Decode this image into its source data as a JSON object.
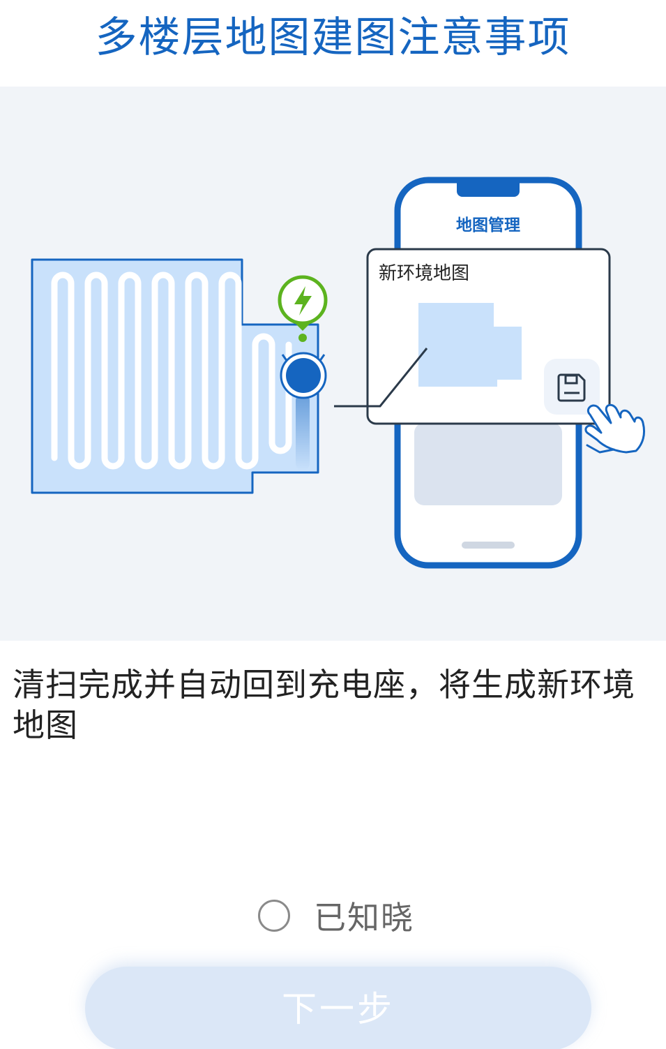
{
  "page": {
    "title": "多楼层地图建图注意事项",
    "description": "清扫完成并自动回到充电座，将生成新环境地图"
  },
  "illustration": {
    "phone_header": "地图管理",
    "popup_title": "新环境地图",
    "icons": [
      "charging-bolt-icon",
      "robot-vacuum-icon",
      "save-icon",
      "hand-pointer-icon"
    ]
  },
  "acknowledge": {
    "label": "已知晓",
    "checked": false
  },
  "next_button": {
    "label": "下一步",
    "enabled": false
  },
  "colors": {
    "accent": "#1565c0",
    "map_fill": "#c9e1fb",
    "charge_green": "#5cb31f",
    "button_disabled": "#dbe7f7"
  }
}
